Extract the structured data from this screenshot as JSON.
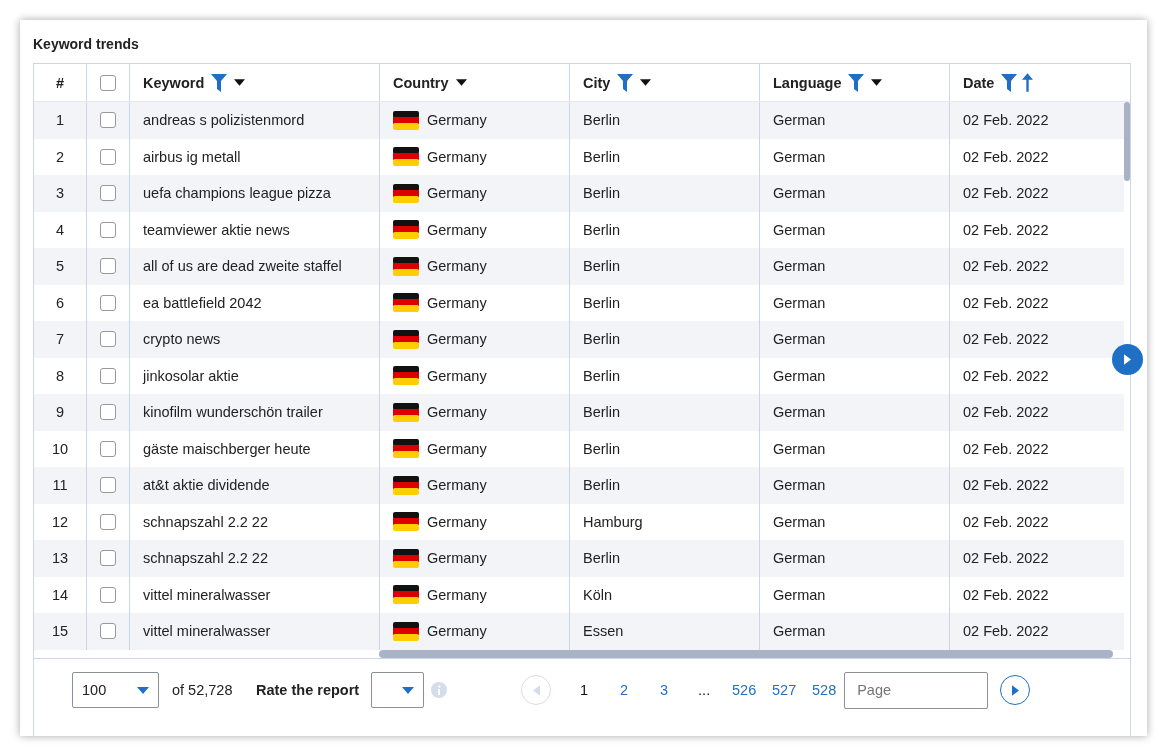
{
  "title": "Keyword trends",
  "table": {
    "columns": [
      {
        "label": "#",
        "kind": "index"
      },
      {
        "kind": "check",
        "checked": false
      },
      {
        "label": "Keyword",
        "kind": "text",
        "filtered": true,
        "dropdown": true
      },
      {
        "label": "Country",
        "kind": "country",
        "dropdown": true
      },
      {
        "label": "City",
        "kind": "text",
        "filtered": true,
        "dropdown": true
      },
      {
        "label": "Language",
        "kind": "text",
        "filtered": true,
        "dropdown": true
      },
      {
        "label": "Date",
        "kind": "text",
        "filtered": true,
        "sort_ascending": true
      }
    ],
    "rows": [
      {
        "number": "1",
        "checked": false,
        "keyword": "andreas s polizistenmord",
        "country": "Germany",
        "city": "Berlin",
        "language": "German",
        "date": "02 Feb. 2022"
      },
      {
        "number": "2",
        "checked": false,
        "keyword": "airbus ig metall",
        "country": "Germany",
        "city": "Berlin",
        "language": "German",
        "date": "02 Feb. 2022"
      },
      {
        "number": "3",
        "checked": false,
        "keyword": "uefa champions league pizza",
        "country": "Germany",
        "city": "Berlin",
        "language": "German",
        "date": "02 Feb. 2022"
      },
      {
        "number": "4",
        "checked": false,
        "keyword": "teamviewer aktie news",
        "country": "Germany",
        "city": "Berlin",
        "language": "German",
        "date": "02 Feb. 2022"
      },
      {
        "number": "5",
        "checked": false,
        "keyword": "all of us are dead zweite staffel",
        "country": "Germany",
        "city": "Berlin",
        "language": "German",
        "date": "02 Feb. 2022"
      },
      {
        "number": "6",
        "checked": false,
        "keyword": "ea battlefield 2042",
        "country": "Germany",
        "city": "Berlin",
        "language": "German",
        "date": "02 Feb. 2022"
      },
      {
        "number": "7",
        "checked": false,
        "keyword": "crypto news",
        "country": "Germany",
        "city": "Berlin",
        "language": "German",
        "date": "02 Feb. 2022"
      },
      {
        "number": "8",
        "checked": false,
        "keyword": "jinkosolar aktie",
        "country": "Germany",
        "city": "Berlin",
        "language": "German",
        "date": "02 Feb. 2022"
      },
      {
        "number": "9",
        "checked": false,
        "keyword": "kinofilm wunderschön trailer",
        "country": "Germany",
        "city": "Berlin",
        "language": "German",
        "date": "02 Feb. 2022"
      },
      {
        "number": "10",
        "checked": false,
        "keyword": "gäste maischberger heute",
        "country": "Germany",
        "city": "Berlin",
        "language": "German",
        "date": "02 Feb. 2022"
      },
      {
        "number": "11",
        "checked": false,
        "keyword": "at&t aktie dividende",
        "country": "Germany",
        "city": "Berlin",
        "language": "German",
        "date": "02 Feb. 2022"
      },
      {
        "number": "12",
        "checked": false,
        "keyword": "schnapszahl 2.2 22",
        "country": "Germany",
        "city": "Hamburg",
        "language": "German",
        "date": "02 Feb. 2022"
      },
      {
        "number": "13",
        "checked": false,
        "keyword": "schnapszahl 2.2 22",
        "country": "Germany",
        "city": "Berlin",
        "language": "German",
        "date": "02 Feb. 2022"
      },
      {
        "number": "14",
        "checked": false,
        "keyword": "vittel mineralwasser",
        "country": "Germany",
        "city": "Köln",
        "language": "German",
        "date": "02 Feb. 2022"
      },
      {
        "number": "15",
        "checked": false,
        "keyword": "vittel mineralwasser",
        "country": "Germany",
        "city": "Essen",
        "language": "German",
        "date": "02 Feb. 2022"
      }
    ]
  },
  "footer": {
    "page_size": "100",
    "total": "of 52,728",
    "rate_label": "Rate the report",
    "pages": [
      {
        "label": "1",
        "selected": true
      },
      {
        "label": "2",
        "selected": false
      },
      {
        "label": "3",
        "selected": false
      },
      {
        "label": "...",
        "kind": "gap"
      },
      {
        "label": "526",
        "selected": false
      },
      {
        "label": "527",
        "selected": false
      },
      {
        "label": "528",
        "selected": false
      }
    ],
    "prev_disabled": true,
    "next_disabled": false,
    "page_placeholder": "Page"
  }
}
